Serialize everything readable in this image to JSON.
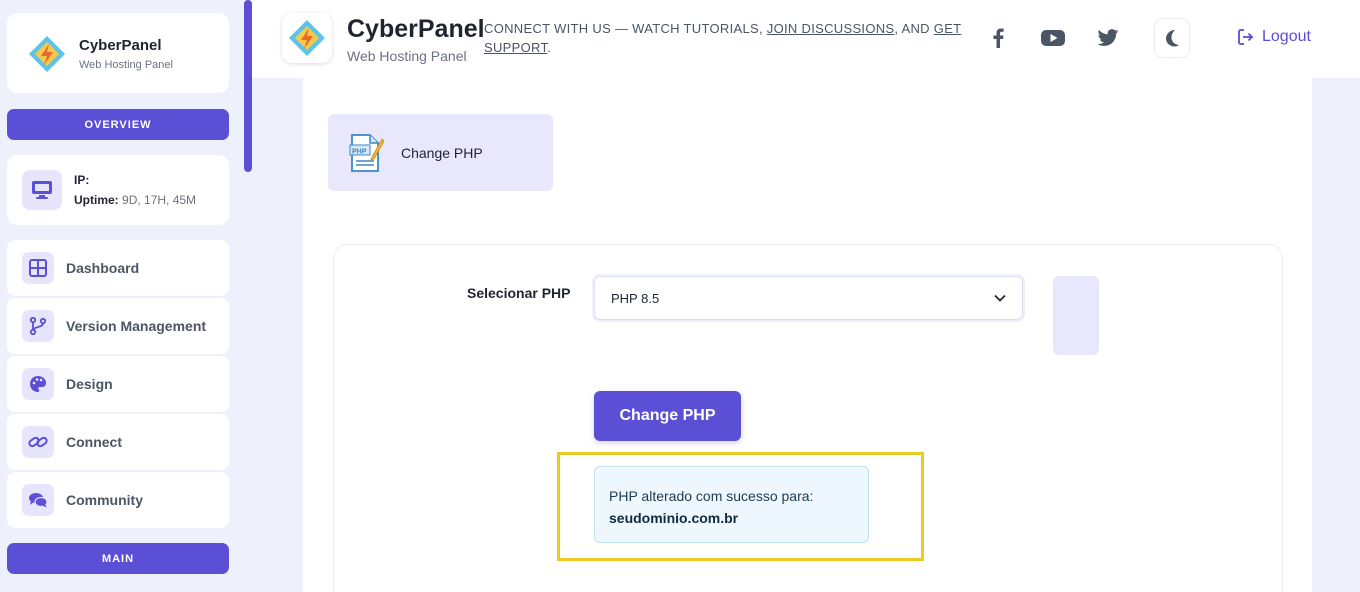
{
  "sidebar": {
    "brand": {
      "title": "CyberPanel",
      "subtitle": "Web Hosting Panel"
    },
    "overview_label": "OVERVIEW",
    "info": {
      "ip_label": "IP:",
      "uptime_label": "Uptime:",
      "uptime_value": "9D, 17H, 45M"
    },
    "items": [
      {
        "label": "Dashboard",
        "icon": "grid-icon"
      },
      {
        "label": "Version Management",
        "icon": "branch-icon"
      },
      {
        "label": "Design",
        "icon": "palette-icon"
      },
      {
        "label": "Connect",
        "icon": "link-icon"
      },
      {
        "label": "Community",
        "icon": "chat-icon"
      }
    ],
    "main_label": "MAIN"
  },
  "header": {
    "title": "CyberPanel",
    "subtitle": "Web Hosting Panel",
    "connect_prefix": "CONNECT WITH US — WATCH TUTORIALS, ",
    "join_link": "JOIN DISCUSSIONS",
    "connect_mid": ", AND ",
    "support_link": "GET SUPPORT",
    "connect_suffix": ".",
    "logout_label": "Logout"
  },
  "main": {
    "tile_label": "Change PHP",
    "field_label": "Selecionar PHP",
    "select_value": "PHP 8.5",
    "button_label": "Change PHP",
    "alert_text": "PHP alterado com sucesso para:",
    "alert_domain": "seudominio.com.br"
  },
  "colors": {
    "accent": "#5b4fd6",
    "highlight": "#e8cb25",
    "alert_bg": "#eef7fd"
  }
}
